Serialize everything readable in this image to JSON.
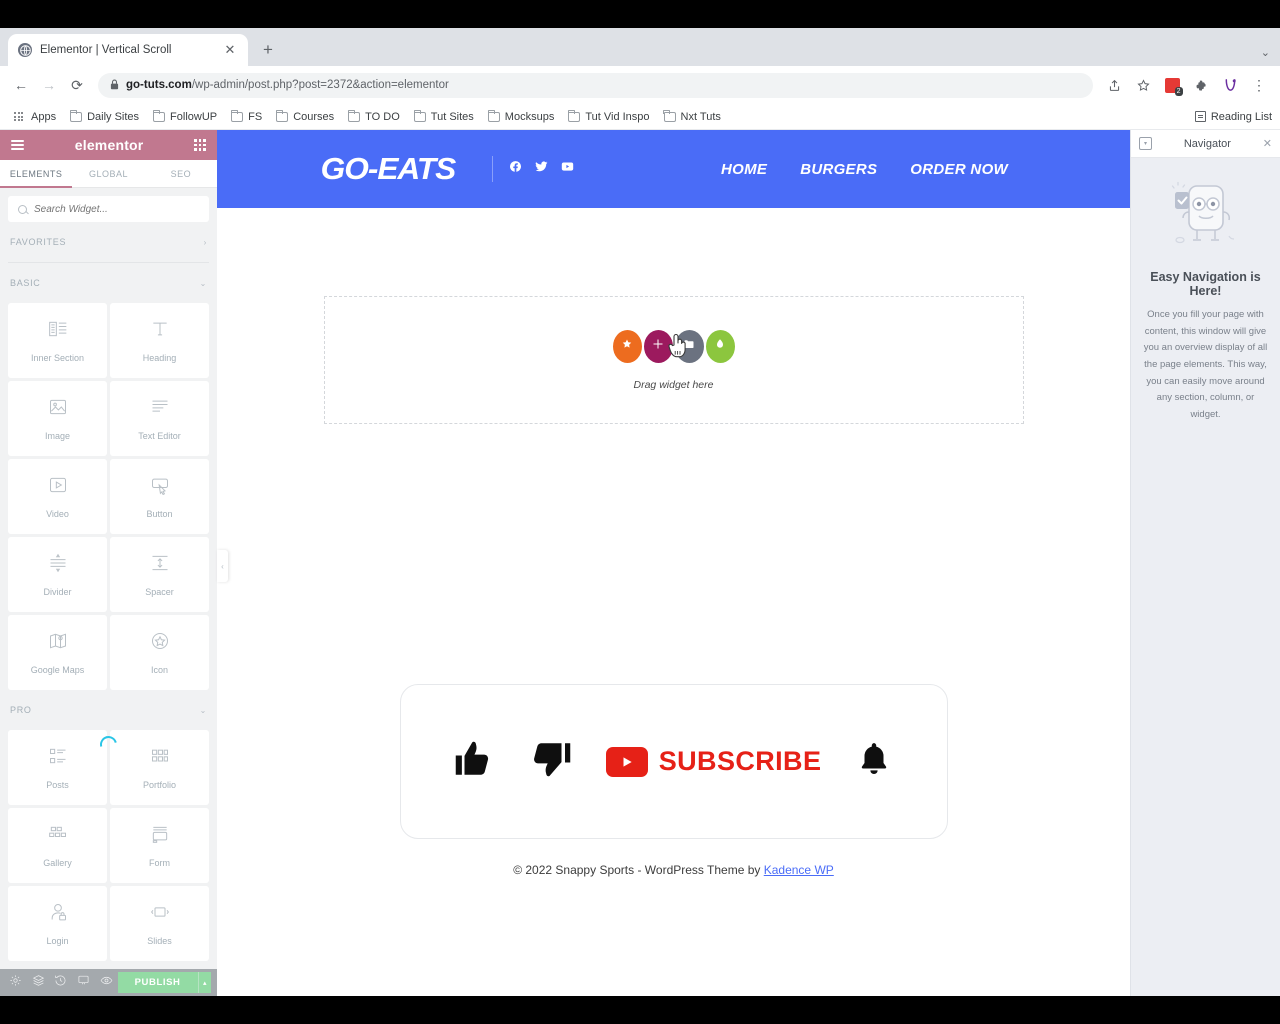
{
  "browser": {
    "tab": {
      "title": "Elementor | Vertical Scroll",
      "favicon": "globe-icon",
      "close": "✕"
    },
    "new_tab": "+",
    "window_caret": "⌄",
    "nav": {
      "back": "←",
      "forward": "→",
      "reload": "⟳"
    },
    "omnibox": {
      "lock": "🔒",
      "domain": "go-tuts.com",
      "path": "/wp-admin/post.php?post=2372&action=elementor"
    },
    "toolbar_right": {
      "share": "⇧",
      "bookmark": "☆",
      "extension_badge": "2",
      "puzzle": "🧩",
      "profile": "V",
      "menu": "⋮"
    },
    "bookmarks": [
      {
        "label": "Apps",
        "icon": "apps-grid-icon"
      },
      {
        "label": "Daily Sites",
        "icon": "folder-icon"
      },
      {
        "label": "FollowUP",
        "icon": "folder-icon"
      },
      {
        "label": "FS",
        "icon": "folder-icon"
      },
      {
        "label": "Courses",
        "icon": "folder-icon"
      },
      {
        "label": "TO DO",
        "icon": "folder-icon"
      },
      {
        "label": "Tut Sites",
        "icon": "folder-icon"
      },
      {
        "label": "Mocksups",
        "icon": "folder-icon"
      },
      {
        "label": "Tut Vid Inspo",
        "icon": "folder-icon"
      },
      {
        "label": "Nxt Tuts",
        "icon": "folder-icon"
      }
    ],
    "reading_list": "Reading List"
  },
  "elementor": {
    "header": {
      "logo": "elementor",
      "menu_icon": "hamburger-icon",
      "grid_icon": "apps-grid-icon"
    },
    "tabs": [
      {
        "label": "ELEMENTS",
        "active": true
      },
      {
        "label": "GLOBAL",
        "active": false
      },
      {
        "label": "SEO",
        "active": false
      }
    ],
    "search": {
      "placeholder": "Search Widget...",
      "value": ""
    },
    "sections": [
      {
        "label": "FAVORITES",
        "caret": "›",
        "expanded": false
      },
      {
        "label": "BASIC",
        "caret": "⌄",
        "expanded": true
      },
      {
        "label": "PRO",
        "caret": "⌄",
        "expanded": true
      }
    ],
    "basic_widgets": [
      {
        "label": "Inner Section",
        "icon": "inner-section-icon"
      },
      {
        "label": "Heading",
        "icon": "heading-t-icon"
      },
      {
        "label": "Image",
        "icon": "image-icon"
      },
      {
        "label": "Text Editor",
        "icon": "text-editor-icon"
      },
      {
        "label": "Video",
        "icon": "video-play-icon"
      },
      {
        "label": "Button",
        "icon": "button-cursor-icon"
      },
      {
        "label": "Divider",
        "icon": "divider-icon"
      },
      {
        "label": "Spacer",
        "icon": "spacer-icon"
      },
      {
        "label": "Google Maps",
        "icon": "google-maps-icon"
      },
      {
        "label": "Icon",
        "icon": "star-circle-icon"
      }
    ],
    "pro_widgets": [
      {
        "label": "Posts",
        "icon": "posts-list-icon"
      },
      {
        "label": "Portfolio",
        "icon": "portfolio-grid-icon"
      },
      {
        "label": "Gallery",
        "icon": "gallery-grid-icon"
      },
      {
        "label": "Form",
        "icon": "form-icon"
      },
      {
        "label": "Login",
        "icon": "login-user-lock-icon"
      },
      {
        "label": "Slides",
        "icon": "slides-icon"
      }
    ],
    "footer": {
      "buttons": [
        {
          "name": "settings",
          "icon": "gear-icon"
        },
        {
          "name": "navigator",
          "icon": "layers-icon"
        },
        {
          "name": "history",
          "icon": "history-clock-icon"
        },
        {
          "name": "responsive",
          "icon": "responsive-mode-icon"
        },
        {
          "name": "preview",
          "icon": "eye-icon"
        }
      ],
      "publish_label": "PUBLISH",
      "publish_caret": "▴",
      "publish_color": "#93dba4"
    },
    "collapse_handle": "‹",
    "loading_spinner_color": "#29c5e6",
    "accent_color": "#c1788f"
  },
  "site": {
    "header": {
      "logo": "GO-EATS",
      "bg_color": "#4a6cf7",
      "socials": [
        {
          "name": "facebook-icon"
        },
        {
          "name": "twitter-icon"
        },
        {
          "name": "youtube-icon"
        }
      ],
      "nav": [
        {
          "label": "HOME"
        },
        {
          "label": "BURGERS"
        },
        {
          "label": "ORDER NOW"
        }
      ]
    },
    "dropzone": {
      "label": "Drag widget here",
      "buttons": [
        {
          "name": "add-favorite",
          "icon": "star-icon",
          "color": "#ed6c1f"
        },
        {
          "name": "add-widget",
          "icon": "plus-icon",
          "color": "#9c1a5e"
        },
        {
          "name": "add-template",
          "icon": "folder-icon",
          "color": "#6b7280"
        },
        {
          "name": "add-global",
          "icon": "leaf-icon",
          "color": "#8cc63e"
        }
      ],
      "cursor": "hand-pointer-cursor"
    },
    "subscribe": {
      "like": "thumbs-up-icon",
      "dislike": "thumbs-down-icon",
      "youtube_badge": "youtube-play-icon",
      "subscribe_text": "SUBSCRIBE",
      "subscribe_color": "#e62117",
      "bell": "bell-icon"
    },
    "footer": {
      "text": "© 2022 Snappy Sports - WordPress Theme by ",
      "link": "Kadence WP"
    }
  },
  "navigator": {
    "title": "Navigator",
    "dock_icon": "dock-panel-icon",
    "close_icon": "close-icon",
    "mascot": "elementor-mascot-illustration",
    "heading": "Easy Navigation is Here!",
    "body": "Once you fill your page with content, this window will give you an overview display of all the page elements. This way, you can easily move around any section, column, or widget."
  }
}
